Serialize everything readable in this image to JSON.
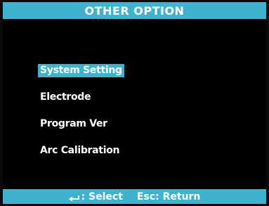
{
  "title": "OTHER OPTION",
  "menu": {
    "items": [
      {
        "label": "System Setting",
        "selected": true
      },
      {
        "label": "Electrode",
        "selected": false
      },
      {
        "label": "Program Ver",
        "selected": false
      },
      {
        "label": "Arc Calibration",
        "selected": false
      }
    ]
  },
  "footer": {
    "select_icon": "enter-icon",
    "select_label": ": Select",
    "esc_key": "Esc",
    "return_label": ": Return"
  },
  "colors": {
    "accent": "#3fb2d0",
    "background": "#000000",
    "text": "#ffffff"
  }
}
